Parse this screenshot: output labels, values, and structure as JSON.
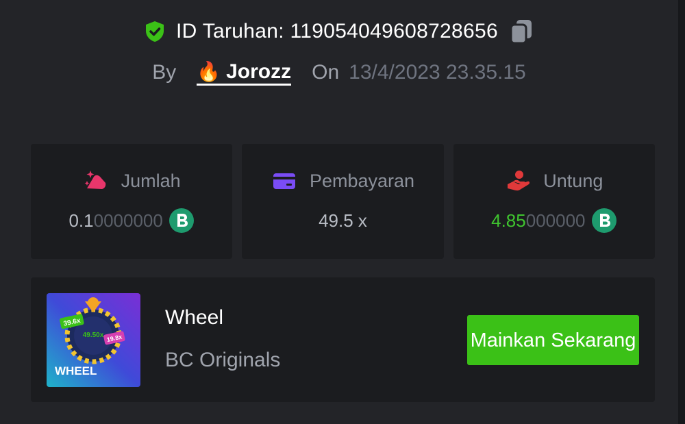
{
  "header": {
    "bet_id_label": "ID Taruhan: 119054049608728656",
    "by_label": "By",
    "username": "Jorozz",
    "on_label": "On",
    "date": "13/4/2023 23.35.15"
  },
  "stats": {
    "amount": {
      "label": "Jumlah",
      "value_main": "0.1",
      "value_dim": "0000000",
      "icon": "bet-amount-icon",
      "color": "#e8366b"
    },
    "payout": {
      "label": "Pembayaran",
      "value": "49.5 x",
      "icon": "card-icon",
      "color": "#7a4cf5"
    },
    "profit": {
      "label": "Untung",
      "value_main": "4.85",
      "value_dim": "000000",
      "icon": "profit-hand-icon",
      "color": "#e0393a"
    }
  },
  "game": {
    "name": "Wheel",
    "provider": "BC Originals",
    "thumb_title": "WHEEL",
    "thumb_multipliers": [
      "39.6x",
      "49.50x",
      "19.8x"
    ],
    "play_label": "Mainkan Sekarang"
  },
  "colors": {
    "background": "#232428",
    "card": "#1b1c1f",
    "accent_green": "#3bc117",
    "profit_green": "#3fc42f",
    "coin": "#1e9b6e"
  }
}
